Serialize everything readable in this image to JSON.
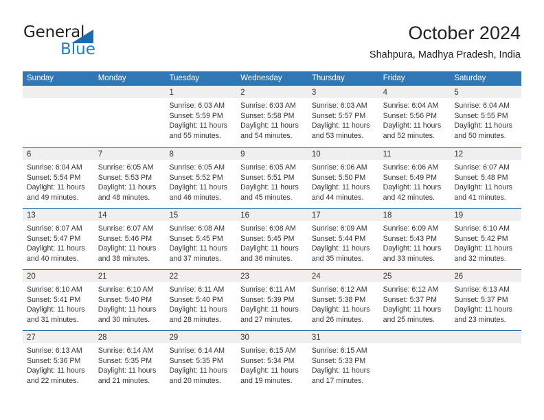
{
  "logo": {
    "word_one": "General",
    "word_two": "Blue",
    "triangle_color": "#1a6cb0",
    "blue_color": "#1a7fd4"
  },
  "header": {
    "title": "October 2024",
    "subtitle": "Shahpura, Madhya Pradesh, India"
  },
  "theme": {
    "header_blue": "#3077b5",
    "row_rule_blue": "#2a6ca8",
    "day_band_gray": "#efefef",
    "text": "#333333"
  },
  "weekdays": [
    "Sunday",
    "Monday",
    "Tuesday",
    "Wednesday",
    "Thursday",
    "Friday",
    "Saturday"
  ],
  "weeks": [
    [
      {
        "day": "",
        "lines": []
      },
      {
        "day": "",
        "lines": []
      },
      {
        "day": "1",
        "lines": [
          "Sunrise: 6:03 AM",
          "Sunset: 5:59 PM",
          "Daylight: 11 hours",
          "and 55 minutes."
        ]
      },
      {
        "day": "2",
        "lines": [
          "Sunrise: 6:03 AM",
          "Sunset: 5:58 PM",
          "Daylight: 11 hours",
          "and 54 minutes."
        ]
      },
      {
        "day": "3",
        "lines": [
          "Sunrise: 6:03 AM",
          "Sunset: 5:57 PM",
          "Daylight: 11 hours",
          "and 53 minutes."
        ]
      },
      {
        "day": "4",
        "lines": [
          "Sunrise: 6:04 AM",
          "Sunset: 5:56 PM",
          "Daylight: 11 hours",
          "and 52 minutes."
        ]
      },
      {
        "day": "5",
        "lines": [
          "Sunrise: 6:04 AM",
          "Sunset: 5:55 PM",
          "Daylight: 11 hours",
          "and 50 minutes."
        ]
      }
    ],
    [
      {
        "day": "6",
        "lines": [
          "Sunrise: 6:04 AM",
          "Sunset: 5:54 PM",
          "Daylight: 11 hours",
          "and 49 minutes."
        ]
      },
      {
        "day": "7",
        "lines": [
          "Sunrise: 6:05 AM",
          "Sunset: 5:53 PM",
          "Daylight: 11 hours",
          "and 48 minutes."
        ]
      },
      {
        "day": "8",
        "lines": [
          "Sunrise: 6:05 AM",
          "Sunset: 5:52 PM",
          "Daylight: 11 hours",
          "and 46 minutes."
        ]
      },
      {
        "day": "9",
        "lines": [
          "Sunrise: 6:05 AM",
          "Sunset: 5:51 PM",
          "Daylight: 11 hours",
          "and 45 minutes."
        ]
      },
      {
        "day": "10",
        "lines": [
          "Sunrise: 6:06 AM",
          "Sunset: 5:50 PM",
          "Daylight: 11 hours",
          "and 44 minutes."
        ]
      },
      {
        "day": "11",
        "lines": [
          "Sunrise: 6:06 AM",
          "Sunset: 5:49 PM",
          "Daylight: 11 hours",
          "and 42 minutes."
        ]
      },
      {
        "day": "12",
        "lines": [
          "Sunrise: 6:07 AM",
          "Sunset: 5:48 PM",
          "Daylight: 11 hours",
          "and 41 minutes."
        ]
      }
    ],
    [
      {
        "day": "13",
        "lines": [
          "Sunrise: 6:07 AM",
          "Sunset: 5:47 PM",
          "Daylight: 11 hours",
          "and 40 minutes."
        ]
      },
      {
        "day": "14",
        "lines": [
          "Sunrise: 6:07 AM",
          "Sunset: 5:46 PM",
          "Daylight: 11 hours",
          "and 38 minutes."
        ]
      },
      {
        "day": "15",
        "lines": [
          "Sunrise: 6:08 AM",
          "Sunset: 5:45 PM",
          "Daylight: 11 hours",
          "and 37 minutes."
        ]
      },
      {
        "day": "16",
        "lines": [
          "Sunrise: 6:08 AM",
          "Sunset: 5:45 PM",
          "Daylight: 11 hours",
          "and 36 minutes."
        ]
      },
      {
        "day": "17",
        "lines": [
          "Sunrise: 6:09 AM",
          "Sunset: 5:44 PM",
          "Daylight: 11 hours",
          "and 35 minutes."
        ]
      },
      {
        "day": "18",
        "lines": [
          "Sunrise: 6:09 AM",
          "Sunset: 5:43 PM",
          "Daylight: 11 hours",
          "and 33 minutes."
        ]
      },
      {
        "day": "19",
        "lines": [
          "Sunrise: 6:10 AM",
          "Sunset: 5:42 PM",
          "Daylight: 11 hours",
          "and 32 minutes."
        ]
      }
    ],
    [
      {
        "day": "20",
        "lines": [
          "Sunrise: 6:10 AM",
          "Sunset: 5:41 PM",
          "Daylight: 11 hours",
          "and 31 minutes."
        ]
      },
      {
        "day": "21",
        "lines": [
          "Sunrise: 6:10 AM",
          "Sunset: 5:40 PM",
          "Daylight: 11 hours",
          "and 30 minutes."
        ]
      },
      {
        "day": "22",
        "lines": [
          "Sunrise: 6:11 AM",
          "Sunset: 5:40 PM",
          "Daylight: 11 hours",
          "and 28 minutes."
        ]
      },
      {
        "day": "23",
        "lines": [
          "Sunrise: 6:11 AM",
          "Sunset: 5:39 PM",
          "Daylight: 11 hours",
          "and 27 minutes."
        ]
      },
      {
        "day": "24",
        "lines": [
          "Sunrise: 6:12 AM",
          "Sunset: 5:38 PM",
          "Daylight: 11 hours",
          "and 26 minutes."
        ]
      },
      {
        "day": "25",
        "lines": [
          "Sunrise: 6:12 AM",
          "Sunset: 5:37 PM",
          "Daylight: 11 hours",
          "and 25 minutes."
        ]
      },
      {
        "day": "26",
        "lines": [
          "Sunrise: 6:13 AM",
          "Sunset: 5:37 PM",
          "Daylight: 11 hours",
          "and 23 minutes."
        ]
      }
    ],
    [
      {
        "day": "27",
        "lines": [
          "Sunrise: 6:13 AM",
          "Sunset: 5:36 PM",
          "Daylight: 11 hours",
          "and 22 minutes."
        ]
      },
      {
        "day": "28",
        "lines": [
          "Sunrise: 6:14 AM",
          "Sunset: 5:35 PM",
          "Daylight: 11 hours",
          "and 21 minutes."
        ]
      },
      {
        "day": "29",
        "lines": [
          "Sunrise: 6:14 AM",
          "Sunset: 5:35 PM",
          "Daylight: 11 hours",
          "and 20 minutes."
        ]
      },
      {
        "day": "30",
        "lines": [
          "Sunrise: 6:15 AM",
          "Sunset: 5:34 PM",
          "Daylight: 11 hours",
          "and 19 minutes."
        ]
      },
      {
        "day": "31",
        "lines": [
          "Sunrise: 6:15 AM",
          "Sunset: 5:33 PM",
          "Daylight: 11 hours",
          "and 17 minutes."
        ]
      },
      {
        "day": "",
        "lines": []
      },
      {
        "day": "",
        "lines": []
      }
    ]
  ]
}
